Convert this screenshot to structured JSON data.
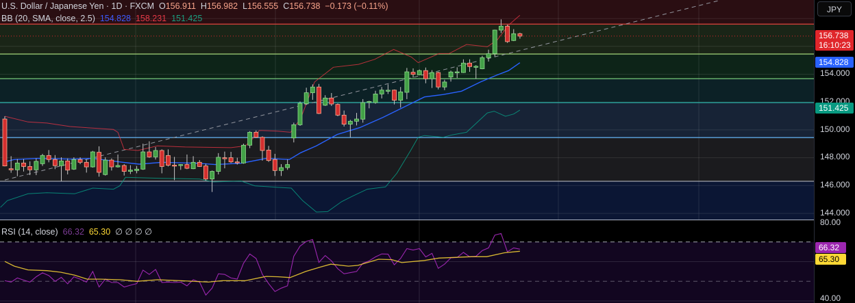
{
  "header": {
    "symbol": "U.S. Dollar / Japanese Yen · 1D · FXCM",
    "o_label": "O",
    "o": "156.911",
    "h_label": "H",
    "h": "156.982",
    "l_label": "L",
    "l": "156.555",
    "c_label": "C",
    "c": "156.738",
    "change": "−0.173 (−0.11%)"
  },
  "bb_legend": {
    "label": "BB (20, SMA, close, 2.5)",
    "basis": "154.828",
    "upper": "158.231",
    "lower": "151.425"
  },
  "rsi_legend": {
    "label": "RSI (14, close)",
    "rsi": "66.32",
    "ma": "65.30",
    "extras": "∅  ∅  ∅  ∅"
  },
  "currency_button": "JPY",
  "price_axis": {
    "ticks": [
      "154.000",
      "152.000",
      "150.000",
      "148.000",
      "146.000",
      "144.000"
    ],
    "last_price": "156.738",
    "countdown": "16:10:23",
    "basis_tag": "154.828",
    "lower_tag": "151.425"
  },
  "rsi_axis": {
    "ticks": [
      "80.00",
      "40.00"
    ],
    "rsi_tag": "66.32",
    "ma_tag": "65.30"
  },
  "colors": {
    "up": "#43a047",
    "up_border": "#8fdc8c",
    "down": "#d32f2f",
    "down_border": "#ffab91",
    "wick": "#c9c9c9",
    "basis": "#2962ff",
    "upper": "#f23645",
    "lower": "#089981",
    "rsi": "#9c27b0",
    "rsi_ma": "#fdd835"
  },
  "chart_data": [
    {
      "type": "candlestick",
      "title": "U.S. Dollar / Japanese Yen · 1D · FXCM",
      "ylim": [
        144,
        159
      ],
      "yticks": [
        144,
        146,
        148,
        150,
        152,
        154
      ],
      "ohlc": [
        [
          150.78,
          150.98,
          147.38,
          147.41
        ],
        [
          147.21,
          148.11,
          146.92,
          147.13
        ],
        [
          147.13,
          147.9,
          146.67,
          147.62
        ],
        [
          147.62,
          147.9,
          147.01,
          147.37
        ],
        [
          147.37,
          147.74,
          146.75,
          147.13
        ],
        [
          147.13,
          147.95,
          146.75,
          147.74
        ],
        [
          147.57,
          148.28,
          147.41,
          148.16
        ],
        [
          148.16,
          148.55,
          147.67,
          147.87
        ],
        [
          147.87,
          148.19,
          147.18,
          147.43
        ],
        [
          147.43,
          148.03,
          146.31,
          147.77
        ],
        [
          147.77,
          147.95,
          146.8,
          147.11
        ],
        [
          147.18,
          148.03,
          147.13,
          147.87
        ],
        [
          147.87,
          148.03,
          147.54,
          147.67
        ],
        [
          147.67,
          147.87,
          146.93,
          147.34
        ],
        [
          147.34,
          148.49,
          147.29,
          148.42
        ],
        [
          148.39,
          148.82,
          146.64,
          146.95
        ],
        [
          146.79,
          148.03,
          146.72,
          147.83
        ],
        [
          147.83,
          147.95,
          147.08,
          147.34
        ],
        [
          147.34,
          148.23,
          147.29,
          147.44
        ],
        [
          147.44,
          147.54,
          146.72,
          147.02
        ],
        [
          147.02,
          147.46,
          146.83,
          147.11
        ],
        [
          147.08,
          147.41,
          146.88,
          147.18
        ],
        [
          147.18,
          149.01,
          147.13,
          148.42
        ],
        [
          148.42,
          149.18,
          148.0,
          148.06
        ],
        [
          148.06,
          148.77,
          147.87,
          148.52
        ],
        [
          148.52,
          148.6,
          146.88,
          147.37
        ],
        [
          148.16,
          148.6,
          147.37,
          147.46
        ],
        [
          147.47,
          148.06,
          146.39,
          147.45
        ],
        [
          147.44,
          147.54,
          147.13,
          147.51
        ],
        [
          147.51,
          148.23,
          147.18,
          147.24
        ],
        [
          147.21,
          148.11,
          147.18,
          147.67
        ],
        [
          147.67,
          147.83,
          147.34,
          147.37
        ],
        [
          147.41,
          147.57,
          146.36,
          146.47
        ],
        [
          146.47,
          147.08,
          145.54,
          147.02
        ],
        [
          147.02,
          148.33,
          146.8,
          148.03
        ],
        [
          148.0,
          148.44,
          147.24,
          147.98
        ],
        [
          148.0,
          148.42,
          147.62,
          147.7
        ],
        [
          147.7,
          148.0,
          147.51,
          147.67
        ],
        [
          147.62,
          149.01,
          147.57,
          148.9
        ],
        [
          148.9,
          149.91,
          148.69,
          149.83
        ],
        [
          149.83,
          149.96,
          149.42,
          149.47
        ],
        [
          149.47,
          149.54,
          147.79,
          148.52
        ],
        [
          148.55,
          148.85,
          147.7,
          147.8
        ],
        [
          147.87,
          148.28,
          146.69,
          147.08
        ],
        [
          147.08,
          147.54,
          146.69,
          147.29
        ],
        [
          147.29,
          147.87,
          147.13,
          147.51
        ],
        [
          149.42,
          150.52,
          149.1,
          150.37
        ],
        [
          150.37,
          152.04,
          150.29,
          151.91
        ],
        [
          151.88,
          153.03,
          151.8,
          152.67
        ],
        [
          152.67,
          153.27,
          152.16,
          153.08
        ],
        [
          153.08,
          153.3,
          151.14,
          151.18
        ],
        [
          151.77,
          152.49,
          151.72,
          152.29
        ],
        [
          152.29,
          152.65,
          151.72,
          151.86
        ],
        [
          151.83,
          151.9,
          150.98,
          151.06
        ],
        [
          151.06,
          151.39,
          150.24,
          150.41
        ],
        [
          150.41,
          150.72,
          149.47,
          150.62
        ],
        [
          150.62,
          151.22,
          150.32,
          150.78
        ],
        [
          150.77,
          152.21,
          150.52,
          151.96
        ],
        [
          152.0,
          152.09,
          151.55,
          152.04
        ],
        [
          151.96,
          152.81,
          151.88,
          152.58
        ],
        [
          152.58,
          153.08,
          152.26,
          152.86
        ],
        [
          152.78,
          153.27,
          152.58,
          152.85
        ],
        [
          152.86,
          152.9,
          151.83,
          152.13
        ],
        [
          152.13,
          153.08,
          151.6,
          152.73
        ],
        [
          152.7,
          154.45,
          152.21,
          154.17
        ],
        [
          154.14,
          154.42,
          153.76,
          153.99
        ],
        [
          153.96,
          154.34,
          153.93,
          154.26
        ],
        [
          154.26,
          154.48,
          153.35,
          153.67
        ],
        [
          153.67,
          154.29,
          153.01,
          154.12
        ],
        [
          154.12,
          154.17,
          152.91,
          153.08
        ],
        [
          153.08,
          153.6,
          152.86,
          153.44
        ],
        [
          153.8,
          154.26,
          153.47,
          154.16
        ],
        [
          154.16,
          154.5,
          153.73,
          154.17
        ],
        [
          154.12,
          155.07,
          154.09,
          154.8
        ],
        [
          154.8,
          155.07,
          154.17,
          154.55
        ],
        [
          154.55,
          154.65,
          153.68,
          154.57
        ],
        [
          154.39,
          155.32,
          154.36,
          155.19
        ],
        [
          155.19,
          155.76,
          154.91,
          155.48
        ],
        [
          155.48,
          157.2,
          155.27,
          157.17
        ],
        [
          157.17,
          157.94,
          156.96,
          157.45
        ],
        [
          157.45,
          157.56,
          156.25,
          156.34
        ],
        [
          156.42,
          157.24,
          156.38,
          156.91
        ],
        [
          156.911,
          156.982,
          156.555,
          156.738
        ]
      ],
      "bb_upper": [
        [
          0,
          150.98
        ],
        [
          3.7,
          150.57
        ],
        [
          6.7,
          150.49
        ],
        [
          10.4,
          150.24
        ],
        [
          14,
          150.13
        ],
        [
          17.3,
          150.03
        ],
        [
          18,
          149.83
        ],
        [
          19,
          148.6
        ],
        [
          21.2,
          148.52
        ],
        [
          24.3,
          148.85
        ],
        [
          28.7,
          148.77
        ],
        [
          36,
          148.72
        ],
        [
          38.3,
          148.85
        ],
        [
          39.4,
          149.34
        ],
        [
          40.5,
          149.96
        ],
        [
          43.4,
          149.91
        ],
        [
          45.5,
          149.83
        ],
        [
          47.1,
          150.82
        ],
        [
          49.3,
          153.44
        ],
        [
          52.3,
          154.5
        ],
        [
          56.3,
          154.71
        ],
        [
          58.9,
          155.07
        ],
        [
          61.9,
          155.78
        ],
        [
          64.7,
          155.24
        ],
        [
          65.8,
          154.83
        ],
        [
          69.1,
          155.48
        ],
        [
          70.7,
          155.48
        ],
        [
          73.5,
          156.14
        ],
        [
          76.8,
          155.97
        ],
        [
          78.4,
          156.47
        ],
        [
          80.2,
          157.53
        ],
        [
          81.5,
          158.05
        ],
        [
          82,
          158.231
        ]
      ],
      "bb_basis": [
        [
          0,
          147.7
        ],
        [
          1.5,
          147.87
        ],
        [
          5.3,
          147.95
        ],
        [
          10.4,
          147.9
        ],
        [
          14,
          147.95
        ],
        [
          18.8,
          147.67
        ],
        [
          21.4,
          147.54
        ],
        [
          25,
          147.67
        ],
        [
          30.6,
          147.6
        ],
        [
          33.5,
          147.51
        ],
        [
          37.6,
          147.6
        ],
        [
          41.6,
          147.95
        ],
        [
          45.3,
          147.87
        ],
        [
          47.1,
          148.36
        ],
        [
          49.6,
          148.85
        ],
        [
          52.9,
          149.67
        ],
        [
          56.5,
          150.16
        ],
        [
          60.2,
          150.9
        ],
        [
          63.9,
          151.72
        ],
        [
          66.8,
          152.37
        ],
        [
          69.8,
          152.54
        ],
        [
          72.7,
          152.78
        ],
        [
          75.7,
          153.44
        ],
        [
          78.3,
          153.93
        ],
        [
          80.2,
          154.26
        ],
        [
          82,
          154.828
        ]
      ],
      "bb_lower": [
        [
          -0.7,
          144.43
        ],
        [
          0.4,
          144.92
        ],
        [
          3.7,
          145.41
        ],
        [
          6.7,
          145.49
        ],
        [
          11.1,
          145.41
        ],
        [
          14,
          145.82
        ],
        [
          17.3,
          145.74
        ],
        [
          18.3,
          145.98
        ],
        [
          19.2,
          146.59
        ],
        [
          25,
          146.52
        ],
        [
          31,
          146.47
        ],
        [
          33.2,
          146.26
        ],
        [
          37.6,
          146.33
        ],
        [
          39.8,
          145.98
        ],
        [
          43.4,
          145.87
        ],
        [
          45.6,
          145.82
        ],
        [
          47.4,
          144.92
        ],
        [
          49.6,
          144.1
        ],
        [
          51.4,
          144.13
        ],
        [
          53.6,
          144.84
        ],
        [
          55.4,
          145.25
        ],
        [
          57.7,
          145.74
        ],
        [
          60.6,
          145.9
        ],
        [
          62.4,
          146.88
        ],
        [
          64.6,
          148.52
        ],
        [
          65.8,
          149.47
        ],
        [
          66.8,
          149.59
        ],
        [
          69.8,
          149.47
        ],
        [
          71.2,
          149.64
        ],
        [
          73.5,
          149.83
        ],
        [
          76.8,
          151.22
        ],
        [
          77.9,
          151.34
        ],
        [
          79.7,
          150.98
        ],
        [
          81,
          151.14
        ],
        [
          82,
          151.425
        ]
      ],
      "levels": [
        {
          "price": 157.6,
          "color": "#e0443e",
          "zone": "#2a0e12"
        },
        {
          "price": 155.45,
          "color": "#a5d67a",
          "zone": "#1a2517"
        },
        {
          "price": 153.68,
          "color": "#77c97a",
          "zone": "#0d2418"
        },
        {
          "price": 151.96,
          "color": "#2bb3a8",
          "zone": "#0c2126"
        },
        {
          "price": 149.45,
          "color": "#64b5f6",
          "zone": "#172336"
        },
        {
          "price": 146.31,
          "color": "#a0a4ac",
          "zone": "#1b1b1e"
        }
      ],
      "bottom_zone": "#0b1634",
      "trendline": [
        [
          0,
          146.4
        ],
        [
          114,
          159.33
        ]
      ],
      "last_price": 156.738
    },
    {
      "type": "line",
      "title": "RSI (14, close)",
      "ylim": [
        40,
        80
      ],
      "bands": [
        70,
        50
      ],
      "rsi": [
        50.3,
        49.6,
        51.7,
        50.6,
        49.6,
        52.3,
        54.3,
        52.9,
        50.0,
        52.0,
        48.7,
        52.3,
        51.1,
        49.6,
        55.0,
        47.1,
        51.1,
        49.4,
        49.4,
        47.1,
        48.0,
        48.8,
        55.7,
        53.5,
        56.0,
        49.4,
        49.6,
        49.4,
        49.6,
        47.7,
        50.8,
        49.6,
        43.0,
        46.5,
        53.8,
        53.5,
        51.7,
        51.1,
        59.2,
        63.9,
        61.6,
        53.5,
        48.8,
        44.8,
        46.5,
        47.7,
        62.7,
        67.9,
        70.3,
        71.2,
        59.6,
        63.1,
        60.4,
        56.4,
        53.8,
        54.4,
        55.0,
        59.2,
        60.4,
        62.4,
        63.9,
        63.8,
        58.4,
        61.6,
        66.6,
        65.9,
        66.6,
        62.4,
        64.2,
        56.6,
        58.7,
        61.9,
        62.1,
        64.7,
        62.4,
        62.7,
        65.6,
        67.0,
        73.5,
        74.3,
        65.0,
        67.0,
        66.32
      ],
      "rsi_ma": [
        [
          0,
          60.1
        ],
        [
          1.5,
          57.7
        ],
        [
          3.7,
          55.8
        ],
        [
          6.7,
          55.4
        ],
        [
          8.9,
          54.6
        ],
        [
          11.1,
          53.1
        ],
        [
          13.1,
          51.1
        ],
        [
          15.2,
          51.1
        ],
        [
          18.4,
          50.8
        ],
        [
          21,
          50.0
        ],
        [
          24.3,
          50.8
        ],
        [
          28,
          50.3
        ],
        [
          32.4,
          49.6
        ],
        [
          34.6,
          50.3
        ],
        [
          38.3,
          50.3
        ],
        [
          41.6,
          52.5
        ],
        [
          43.5,
          52.3
        ],
        [
          45.4,
          51.9
        ],
        [
          47.9,
          55.0
        ],
        [
          50.3,
          57.3
        ],
        [
          51.9,
          58.7
        ],
        [
          54.7,
          57.7
        ],
        [
          56.2,
          58.1
        ],
        [
          59.5,
          61.2
        ],
        [
          61.6,
          61.0
        ],
        [
          63.2,
          59.5
        ],
        [
          66.8,
          60.6
        ],
        [
          69.1,
          61.8
        ],
        [
          74.2,
          62.5
        ],
        [
          76.7,
          62.5
        ],
        [
          79.5,
          64.5
        ],
        [
          82,
          65.3
        ]
      ]
    }
  ]
}
